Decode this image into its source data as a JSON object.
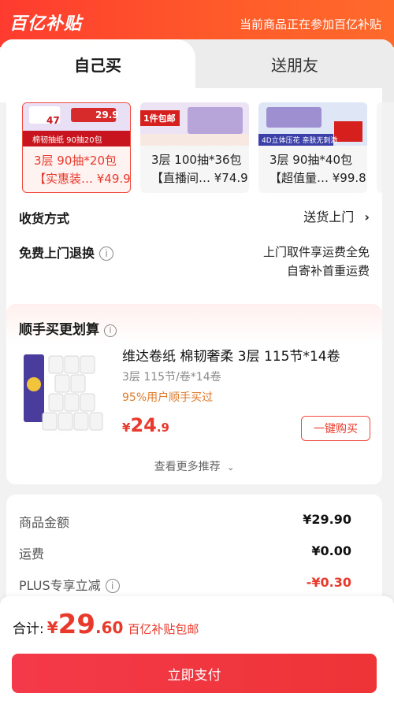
{
  "banner": {
    "logo": "百亿补贴",
    "notice": "当前商品正在参加百亿补贴"
  },
  "tabs": [
    {
      "label": "自己买",
      "active": true
    },
    {
      "label": "送朋友",
      "active": false
    }
  ],
  "products": [
    {
      "line1": "3层 90抽*20包",
      "line2": "【实惠装… ¥49.9",
      "selected": true,
      "thumb_caption": "棉韧抽纸 90抽20包",
      "badge_price_a": "47",
      "badge_price_b": "29.9"
    },
    {
      "line1": "3层 100抽*36包",
      "line2": "【直播间… ¥74.9",
      "selected": false,
      "thumb_caption": "1件包邮"
    },
    {
      "line1": "3层 90抽*40包",
      "line2": "【超值量… ¥99.8",
      "selected": false,
      "thumb_caption": "4D立体压花 亲肤无刺激"
    }
  ],
  "delivery": {
    "label": "收货方式",
    "value": "送货上门"
  },
  "returns": {
    "label": "免费上门退换",
    "value_line1": "上门取件享运费全免",
    "value_line2": "自寄补首重运费"
  },
  "addon": {
    "title": "顺手买更划算",
    "name": "维达卷纸 棉韧奢柔 3层 115节*14卷",
    "spec": "3层 115节/卷*14卷",
    "percent": "95%用户顺手买过",
    "price_currency": "¥",
    "price_int": "24",
    "price_dec": ".9",
    "buy_label": "一键购买",
    "more_label": "查看更多推荐"
  },
  "summary": [
    {
      "label": "商品金额",
      "value": "¥29.90",
      "highlight": false,
      "info": false
    },
    {
      "label": "运费",
      "value": "¥0.00",
      "highlight": false,
      "info": false
    },
    {
      "label": "PLUS专享立减",
      "value": "-¥0.30",
      "highlight": true,
      "info": true
    }
  ],
  "footer": {
    "total_label": "合计:",
    "currency": "¥",
    "total_int": "29",
    "total_dec": ".60",
    "note": "百亿补贴包邮",
    "pay_label": "立即支付"
  },
  "colors": {
    "brand_red": "#e8392c",
    "banner_orange": "#ff5a2a",
    "pay_button": "#f13a40"
  }
}
